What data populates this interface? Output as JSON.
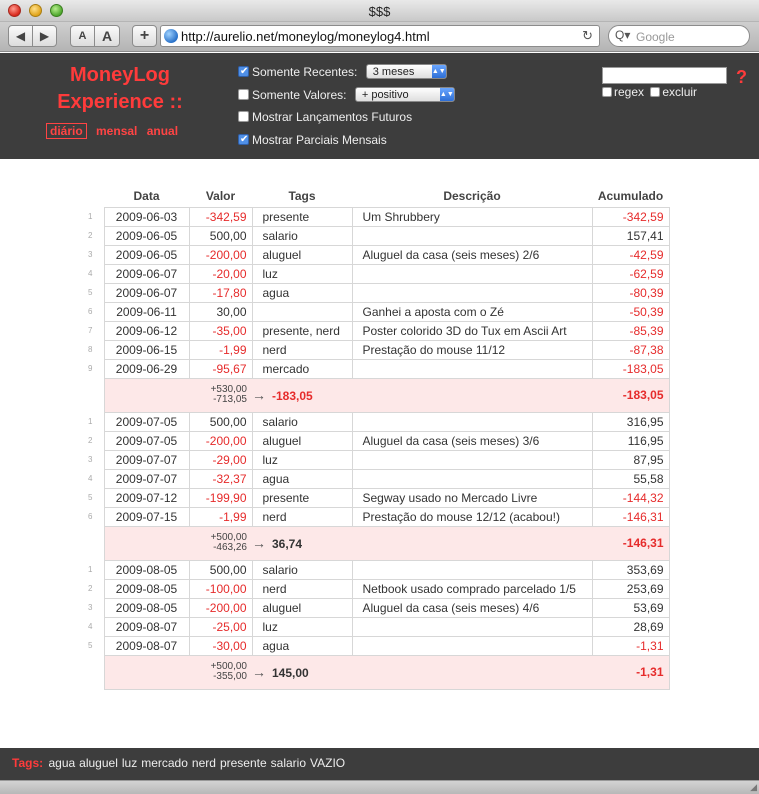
{
  "window": {
    "title": "$$$"
  },
  "toolbar": {
    "back": "◀",
    "forward": "▶",
    "font_small": "A",
    "font_big": "A",
    "add": "+",
    "url": "http://aurelio.net/moneylog/moneylog4.html",
    "reload": "↻",
    "search_placeholder": "Google",
    "search_icon": "Q▾"
  },
  "app": {
    "title": "MoneyLog Experience ::",
    "views": {
      "daily": "diário",
      "monthly": "mensal",
      "yearly": "anual"
    },
    "options": {
      "recent_label": "Somente Recentes:",
      "recent_value": "3 meses",
      "values_label": "Somente Valores:",
      "values_value": "+ positivo",
      "future_label": "Mostrar Lançamentos Futuros",
      "partials_label": "Mostrar Parciais Mensais"
    },
    "filter": {
      "regex_label": "regex",
      "exclude_label": "excluir",
      "help": "?"
    }
  },
  "table": {
    "headers": {
      "date": "Data",
      "value": "Valor",
      "tags": "Tags",
      "desc": "Descrição",
      "acc": "Acumulado"
    },
    "months": [
      {
        "rows": [
          {
            "n": "1",
            "date": "2009-06-03",
            "value": "-342,59",
            "tags": "presente",
            "desc": "Um Shrubbery",
            "acc": "-342,59"
          },
          {
            "n": "2",
            "date": "2009-06-05",
            "value": "500,00",
            "tags": "salario",
            "desc": "",
            "acc": "157,41"
          },
          {
            "n": "3",
            "date": "2009-06-05",
            "value": "-200,00",
            "tags": "aluguel",
            "desc": "Aluguel da casa (seis meses) 2/6",
            "acc": "-42,59"
          },
          {
            "n": "4",
            "date": "2009-06-07",
            "value": "-20,00",
            "tags": "luz",
            "desc": "",
            "acc": "-62,59"
          },
          {
            "n": "5",
            "date": "2009-06-07",
            "value": "-17,80",
            "tags": "agua",
            "desc": "",
            "acc": "-80,39"
          },
          {
            "n": "6",
            "date": "2009-06-11",
            "value": "30,00",
            "tags": "",
            "desc": "Ganhei a aposta com o Zé",
            "acc": "-50,39"
          },
          {
            "n": "7",
            "date": "2009-06-12",
            "value": "-35,00",
            "tags": "presente, nerd",
            "desc": "Poster colorido 3D do Tux em Ascii Art",
            "acc": "-85,39"
          },
          {
            "n": "8",
            "date": "2009-06-15",
            "value": "-1,99",
            "tags": "nerd",
            "desc": "Prestação do mouse 11/12",
            "acc": "-87,38"
          },
          {
            "n": "9",
            "date": "2009-06-29",
            "value": "-95,67",
            "tags": "mercado",
            "desc": "",
            "acc": "-183,05"
          }
        ],
        "summary": {
          "plus": "+530,00",
          "minus": "-713,05",
          "arrow": "→",
          "total": "-183,05",
          "acc": "-183,05"
        }
      },
      {
        "rows": [
          {
            "n": "1",
            "date": "2009-07-05",
            "value": "500,00",
            "tags": "salario",
            "desc": "",
            "acc": "316,95"
          },
          {
            "n": "2",
            "date": "2009-07-05",
            "value": "-200,00",
            "tags": "aluguel",
            "desc": "Aluguel da casa (seis meses) 3/6",
            "acc": "116,95"
          },
          {
            "n": "3",
            "date": "2009-07-07",
            "value": "-29,00",
            "tags": "luz",
            "desc": "",
            "acc": "87,95"
          },
          {
            "n": "4",
            "date": "2009-07-07",
            "value": "-32,37",
            "tags": "agua",
            "desc": "",
            "acc": "55,58"
          },
          {
            "n": "5",
            "date": "2009-07-12",
            "value": "-199,90",
            "tags": "presente",
            "desc": "Segway usado no Mercado Livre",
            "acc": "-144,32"
          },
          {
            "n": "6",
            "date": "2009-07-15",
            "value": "-1,99",
            "tags": "nerd",
            "desc": "Prestação do mouse 12/12 (acabou!)",
            "acc": "-146,31"
          }
        ],
        "summary": {
          "plus": "+500,00",
          "minus": "-463,26",
          "arrow": "→",
          "total": "36,74",
          "acc": "-146,31"
        }
      },
      {
        "rows": [
          {
            "n": "1",
            "date": "2009-08-05",
            "value": "500,00",
            "tags": "salario",
            "desc": "",
            "acc": "353,69"
          },
          {
            "n": "2",
            "date": "2009-08-05",
            "value": "-100,00",
            "tags": "nerd",
            "desc": "Netbook usado comprado parcelado 1/5",
            "acc": "253,69"
          },
          {
            "n": "3",
            "date": "2009-08-05",
            "value": "-200,00",
            "tags": "aluguel",
            "desc": "Aluguel da casa (seis meses) 4/6",
            "acc": "53,69"
          },
          {
            "n": "4",
            "date": "2009-08-07",
            "value": "-25,00",
            "tags": "luz",
            "desc": "",
            "acc": "28,69"
          },
          {
            "n": "5",
            "date": "2009-08-07",
            "value": "-30,00",
            "tags": "agua",
            "desc": "",
            "acc": "-1,31"
          }
        ],
        "summary": {
          "plus": "+500,00",
          "minus": "-355,00",
          "arrow": "→",
          "total": "145,00",
          "acc": "-1,31"
        }
      }
    ]
  },
  "footer": {
    "tags_label": "Tags:",
    "tags": [
      "agua",
      "aluguel",
      "luz",
      "mercado",
      "nerd",
      "presente",
      "salario",
      "VAZIO"
    ]
  },
  "colors": {
    "accent": "#ff3b3b",
    "negative": "#e62b2b",
    "header_bg": "#3d3d3d",
    "summary_bg": "#fde8e8"
  }
}
